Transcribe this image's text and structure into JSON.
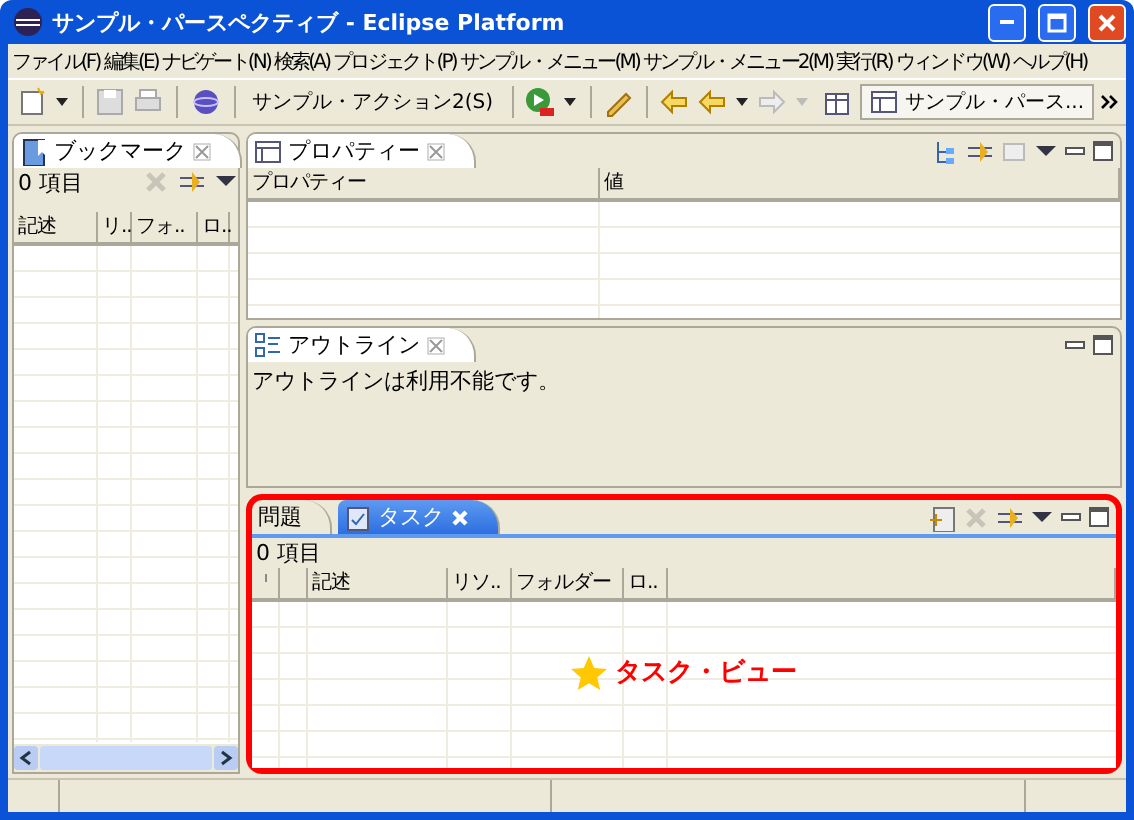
{
  "window": {
    "title": "サンプル・パースペクティブ - Eclipse Platform"
  },
  "menu": [
    "ファイル(F)",
    "編集(E)",
    "ナビゲート(N)",
    "検索(A)",
    "プロジェクト(P)",
    "サンプル・メニュー(M)",
    "サンプル・メニュー2(M)",
    "実行(R)",
    "ウィンドウ(W)",
    "ヘルプ(H)"
  ],
  "toolbar": {
    "action": "サンプル・アクション2(S)",
    "perspective": "サンプル・パース..."
  },
  "bookmarks": {
    "title": "ブックマーク",
    "count": "0 項目",
    "columns": [
      "記述",
      "リ..",
      "フォ..",
      "ロ.."
    ]
  },
  "properties": {
    "title": "プロパティー",
    "columns": [
      "プロパティー",
      "値"
    ]
  },
  "outline": {
    "title": "アウトライン",
    "message": "アウトラインは利用不能です。"
  },
  "tasks": {
    "tabs": [
      {
        "label": "問題",
        "selected": false
      },
      {
        "label": "タスク",
        "selected": true
      }
    ],
    "count": "0 項目",
    "columns": [
      "記述",
      "リソ..",
      "フォルダー",
      "ロ.."
    ],
    "callout": "タスク・ビュー"
  }
}
